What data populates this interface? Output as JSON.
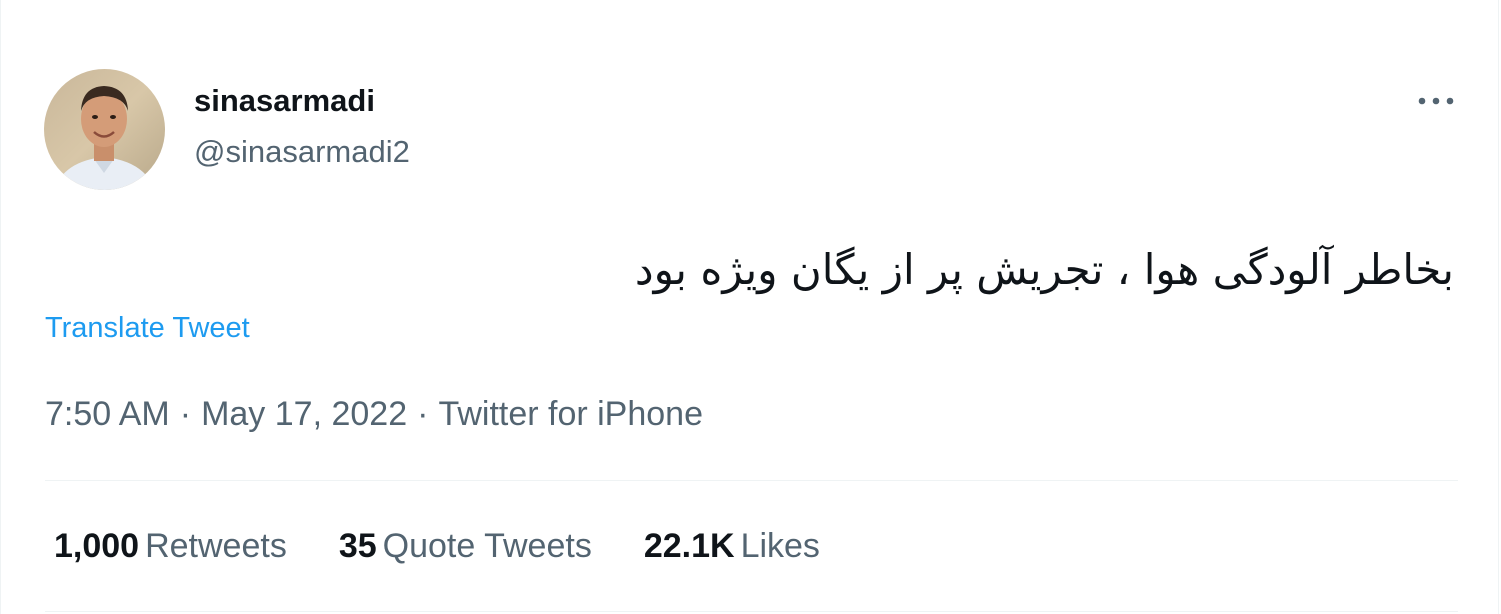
{
  "tweet": {
    "display_name": "sinasarmadi",
    "handle": "@sinasarmadi2",
    "more_icon": "more-horizontal-icon",
    "text": "بخاطر آلودگی هوا ، تجریش پر از یگان ویژه بود",
    "translate_label": "Translate Tweet",
    "time": "7:50 AM",
    "separator": "·",
    "date": "May 17, 2022",
    "source": "Twitter for iPhone",
    "stats": {
      "retweets_count": "1,000",
      "retweets_label": "Retweets",
      "quotes_count": "35",
      "quotes_label": "Quote Tweets",
      "likes_count": "22.1K",
      "likes_label": "Likes"
    }
  },
  "colors": {
    "primary_text": "#0f1419",
    "secondary_text": "#536471",
    "link": "#1d9bf0",
    "divider": "#eff3f4"
  }
}
